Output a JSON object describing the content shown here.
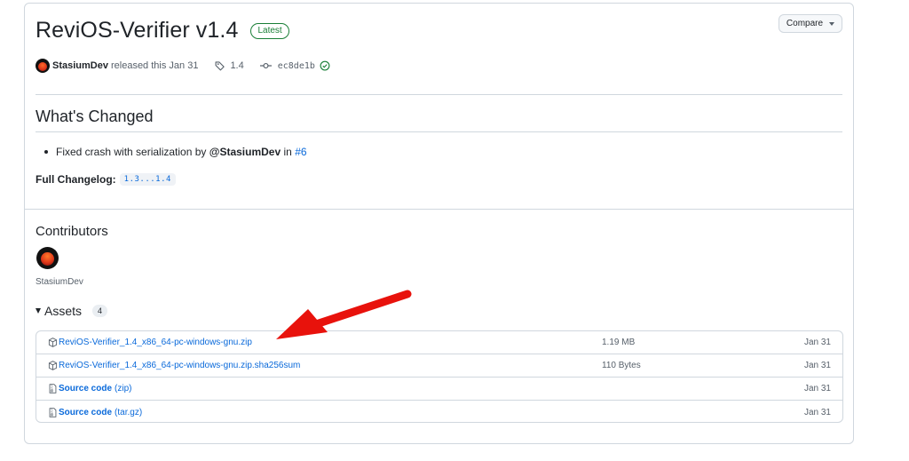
{
  "release": {
    "title": "ReviOS-Verifier v1.4",
    "badge": "Latest",
    "compare_label": "Compare",
    "author": "StasiumDev",
    "released_text": "released this Jan 31",
    "tag": "1.4",
    "commit": "ec8de1b"
  },
  "whats_changed": {
    "heading": "What's Changed",
    "item": {
      "prefix": "Fixed crash with serialization by",
      "mention": "@StasiumDev",
      "in_text": "in",
      "pr": "#6"
    },
    "changelog_label": "Full Changelog:",
    "changelog_range": "1.3...1.4"
  },
  "contributors": {
    "heading": "Contributors",
    "name": "StasiumDev"
  },
  "assets": {
    "heading": "Assets",
    "count": "4",
    "items": [
      {
        "name": "ReviOS-Verifier_1.4_x86_64-pc-windows-gnu.zip",
        "suffix": "",
        "size": "1.19 MB",
        "date": "Jan 31",
        "icon": "package-icon"
      },
      {
        "name": "ReviOS-Verifier_1.4_x86_64-pc-windows-gnu.zip.sha256sum",
        "suffix": "",
        "size": "110 Bytes",
        "date": "Jan 31",
        "icon": "package-icon"
      },
      {
        "name": "Source code",
        "suffix": "(zip)",
        "size": "",
        "date": "Jan 31",
        "icon": "file-zip-icon"
      },
      {
        "name": "Source code",
        "suffix": "(tar.gz)",
        "size": "",
        "date": "Jan 31",
        "icon": "file-zip-icon"
      }
    ]
  },
  "colors": {
    "link": "#0969da",
    "latest_badge": "#1a7f37",
    "annotation_arrow": "#e8120c"
  }
}
